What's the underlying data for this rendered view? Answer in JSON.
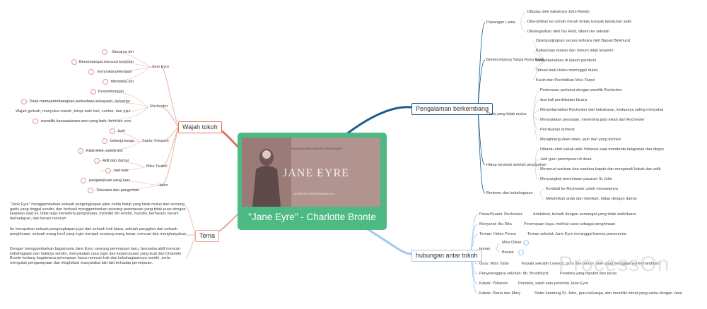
{
  "center": {
    "title": "\"Jane Eyre\" - Charlotte Bronte",
    "poster": {
      "title": "JANE EYRE",
      "credits": "MIA WASIKOWSKA  MICHAEL FASSBENDER",
      "subline": "IN SELECT THEATRES MARCH 11"
    }
  },
  "left": {
    "wajah": {
      "label": "Wajah tokoh",
      "groups": [
        {
          "name": "Jane Eyre",
          "items": [
            "Benama diri",
            "Bersemangat mencari keadilan",
            "menyukai pekerjaan",
            "Membela diri"
          ]
        },
        {
          "name": "Rochester",
          "items": [
            "Kesombongan",
            "Tidak mempertimbangkan perbedaan kekayaan, keluarga",
            "Wajah gelisah, menyukai marah, tetapi baik hati, cerdas, dan jujur",
            "memiliki kesusastraan seni yang baik, bermain seni"
          ]
        },
        {
          "name": "Santa Yohanes",
          "items": [
            "baik",
            "bekerja keras",
            "Kikik kikik, autokratis"
          ]
        },
        {
          "name": "Miss Taubol",
          "items": [
            "Adil dan damai",
            "hati baik"
          ]
        },
        {
          "name": "Helen",
          "items": [
            "pengetahuan yang luas",
            "Toleransi dan pengertian"
          ]
        }
      ]
    },
    "tema": {
      "label": "Tema",
      "paragraphs": [
        "\"Jane Eyre\" menggambarkan sebuah pengungkapan jalan cerita hidup yang tidak mulus dari seorang gadis yang tinggal sendiri, dan berhasil menggambarkan seorang perempuan yang tidak puas dengan keadaan saat ini, tidak tega menerima penghinaan, memiliki diri sendiri, mandiri, berhasrat, berani berhadapan, dan berani mencari",
        "Itu merupakan sebuah pengungkapan jujur dari sebuah hati biasa, sebuah panggilan dari sebuah penghinaan, sebuah orang kecil yang ingin menjadi seorang orang besar, mencari dan menghargakan",
        "Dengan menggambarkan bagaimana Jane Eyre, seorang perempuan baru, berusaha aktif mencari kebahagiaan dan hakinya sendiri, menyatakan rasa ingin dan kepercayaan yang kuat dari Charlotte Bronte tentang bagaimana perempuan harus mencari hak dan kebahagiaannya sendiri, serta mengutuk penganiayaan dan eksploitasi masyarakat laki-laki terhadap perempuan."
      ]
    }
  },
  "right": {
    "pengalaman": {
      "label": "Pengalaman berkembang",
      "groups": [
        {
          "name": "Pasangan Lama",
          "items": [
            "Dibalas oleh kakaknya John Reedo",
            "Dibersihkan ke rumah merah terlalu banyak ketakutan sakit",
            "Dikategorikan oleh Ibu Reid, dikirim ke sekolah"
          ]
        },
        {
          "name": "Berkecimpung Tanpa Rasa Enak",
          "items": [
            "Dipergunjingkan secara terbuka oleh Bapak Blokhurst",
            "Kebutuhan makan dan minum tidak terjamin",
            "Menyelamatkan di dalam pandemi",
            "Teman baik Helen meninggal dunia",
            "Kasih dan Pendidikan Miss Taipol"
          ]
        },
        {
          "name": "Cinta yang tidak mulus",
          "items": [
            "Pertemuan pertama dengan pemilik Rochester",
            "dua kali perdebatan bicara",
            "Menyelamatkan Rochester dari kebakaran, keduanya saling menyukai",
            "Menyatakan perasaan, menerima janji nikah dari Rochester",
            "Pernikahan terhenti",
            "Menghilang diam-diam, jauh dari yang dicintai"
          ]
        },
        {
          "name": "Hidup terpisah setelah perpisahan",
          "items": [
            "Dibantu oleh kakak-adik Yohanes saat menderita kelaparan dan dingin",
            "Jadi guru perempuan di desa",
            "Menerusi warisan dari saudara bapak dan mengenali kakak dan adik",
            "Menyangkal permintaan pacaran St John"
          ]
        },
        {
          "name": "Bertemu dan kebahagiaan",
          "items": [
            "Kembali ke Rochester untuk merawatnya",
            "Melahirkan anak dan menikah, hidup dengan damai"
          ]
        }
      ]
    },
    "hubungan": {
      "label": "hubungan antar tokoh",
      "rows": [
        {
          "key": "Pacar/Suami: Rochester",
          "value": "Aristokrat, tertarik dengan semangat yang tidak sederhana"
        },
        {
          "key": "Menyurat: Ibu Rita",
          "value": "Perempuan kaya, melihat surat sebagai penghinaan"
        },
        {
          "key": "Teman: Helen Pence",
          "value": "Teman sekolah Jane Eyre meninggal karena pneumonia"
        },
        {
          "key": "teman",
          "subs": [
            "Miss Oliver",
            "Bessie"
          ]
        },
        {
          "key": "Guru: Miss Taibo",
          "value": "Kepala sekolah Lowood, guru dan teman Jane yang mengajarnya kemandirian"
        },
        {
          "key": "Penyelenggara sekolah: Mr. Brockhurst",
          "value": "Pendeta yang hipokrit dan keras"
        },
        {
          "key": "Kakak: Yohanes",
          "value": "Pendeta, salah satu pencinta Jane Eyre"
        },
        {
          "key": "Kakak: Diana dan Mary",
          "value": "Sister kandung St. John, guru keluarga, dan memiliki minat yang sama dengan Jane"
        }
      ]
    }
  },
  "watermark": "ProcessOn",
  "colors": {
    "center": "#4dba84",
    "left_branch": "#e0735e",
    "pengalaman": "#1a5b8f",
    "hubungan": "#9fc9ee",
    "leaf_line": "#e8b4a8"
  }
}
